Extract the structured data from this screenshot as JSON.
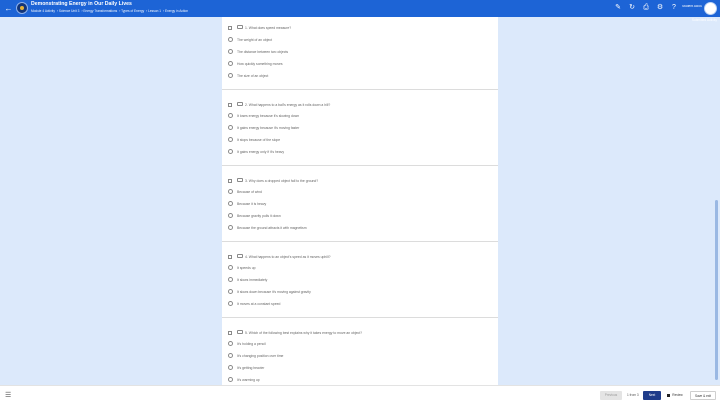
{
  "header": {
    "title": "Demonstrating Energy in Our Daily Lives",
    "breadcrumb": [
      "Module 4 Activity",
      "Science Unit 3",
      "Energy Transformations",
      "Types of Energy",
      "Lesson 1",
      "Energy in Action"
    ],
    "user_name": "Student Account",
    "subtitle_link": "Submitted Activity"
  },
  "questions": [
    {
      "text": "1. What does speed measure?",
      "options": [
        "The weight of an object",
        "The distance between two objects",
        "How quickly something moves",
        "The size of an object"
      ]
    },
    {
      "text": "2. What happens to a ball's energy as it rolls down a hill?",
      "options": [
        "It loses energy because it's slowing down",
        "It gains energy because it's moving faster",
        "It stops because of the slope",
        "It gains energy only if it's heavy"
      ]
    },
    {
      "text": "3. Why does a dropped object fall to the ground?",
      "options": [
        "Because of wind",
        "Because it is heavy",
        "Because gravity pulls it down",
        "Because the ground attracts it with magnetism"
      ]
    },
    {
      "text": "4. What happens to an object's speed as it moves uphill?",
      "options": [
        "It speeds up",
        "It slows immediately",
        "It slows down because it's moving against gravity",
        "It moves at a constant speed"
      ]
    },
    {
      "text": "5. Which of the following best explains why it takes energy to move an object?",
      "options": [
        "It's holding a pencil",
        "It's changing position over time",
        "It's getting heavier",
        "It's warming up"
      ]
    }
  ],
  "footer": {
    "prev_label": "Previous",
    "page_count": "1 from 3",
    "next_label": "Next",
    "review_label": "Review",
    "save_label": "Save & exit"
  }
}
